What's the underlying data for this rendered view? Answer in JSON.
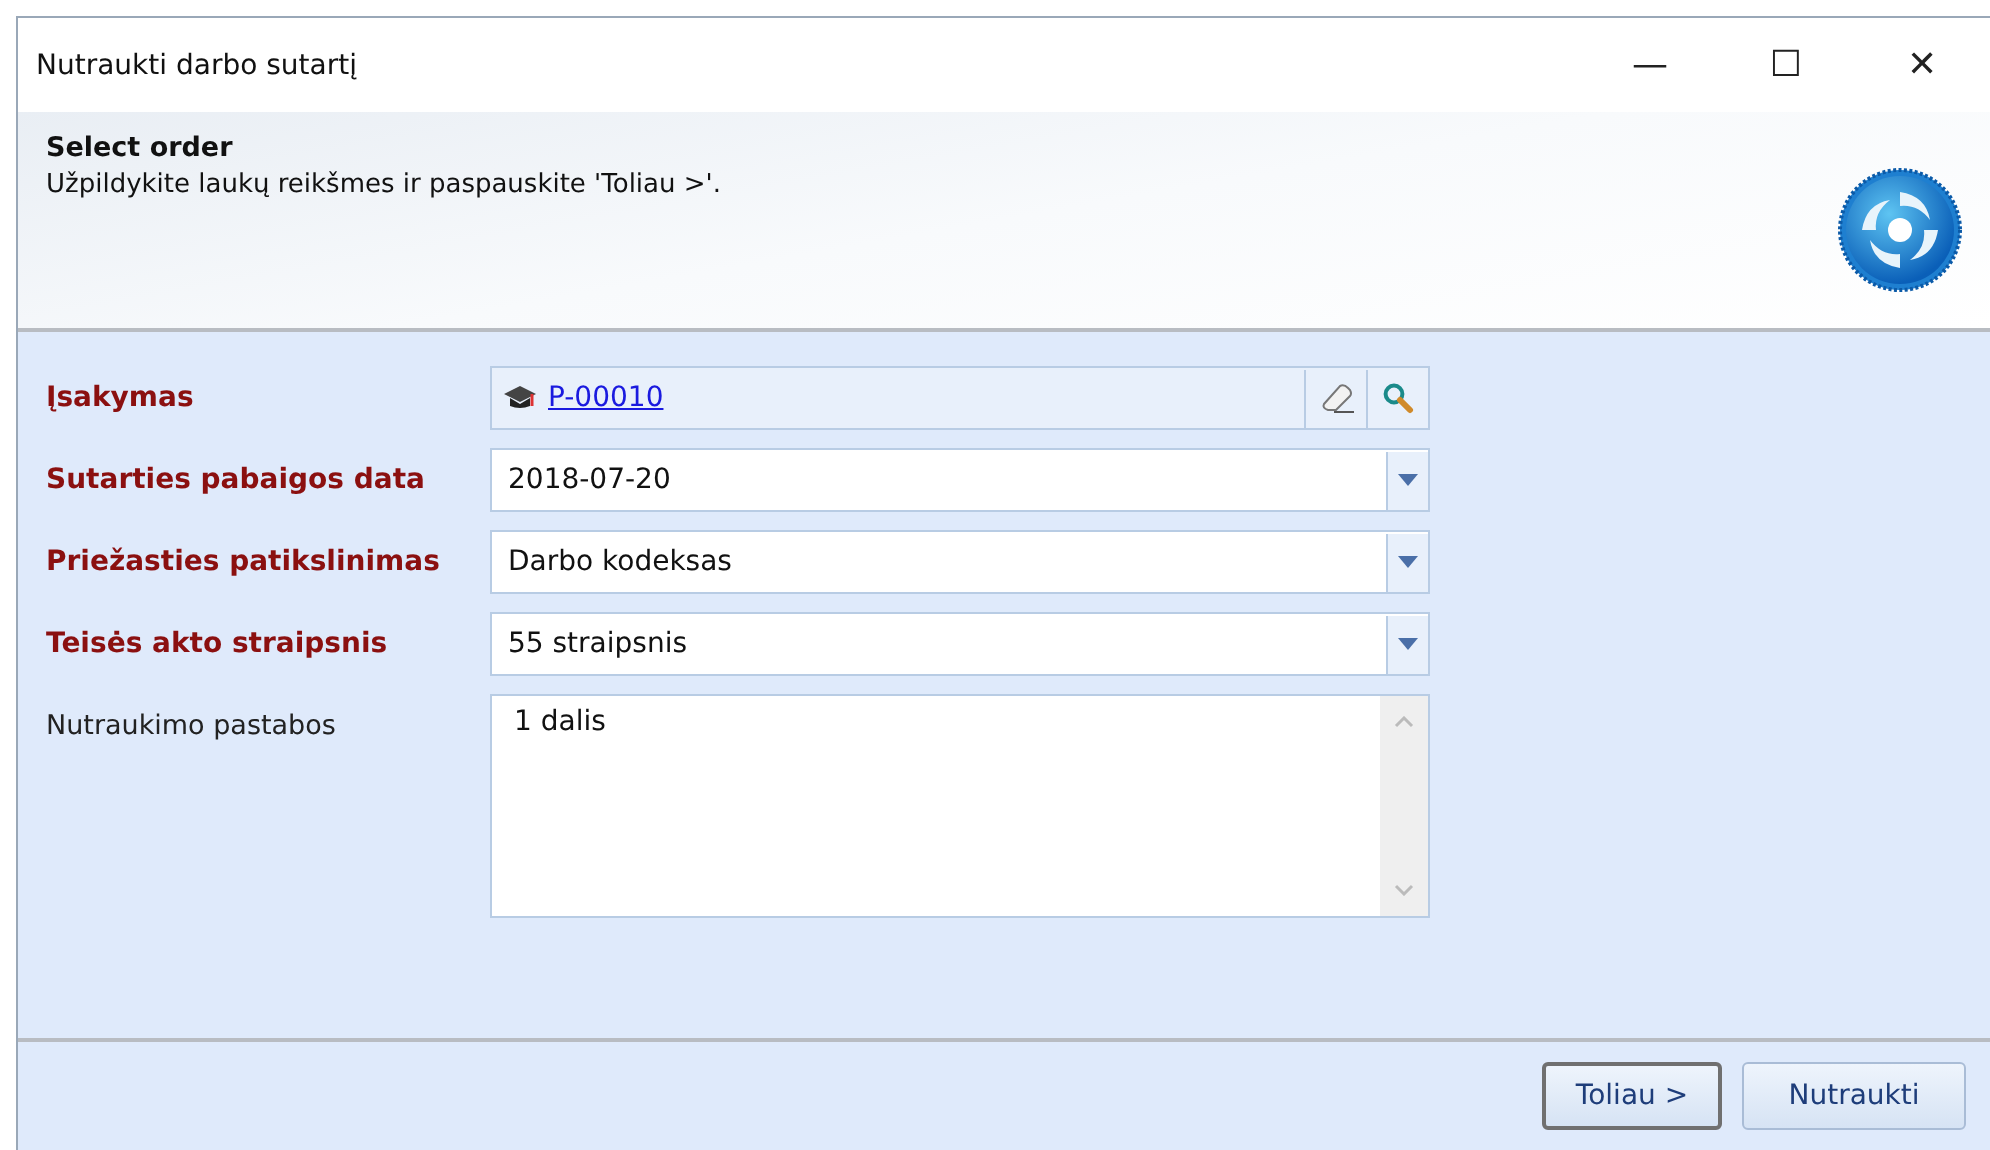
{
  "window": {
    "title": "Nutraukti darbo sutartį",
    "controls": [
      "—",
      "☐",
      "✕"
    ]
  },
  "header": {
    "title": "Select order",
    "subtitle": "Užpildykite laukų reikšmes ir paspauskite 'Toliau >'."
  },
  "fields": [
    {
      "kind": "lookup",
      "label": "Įsakymas",
      "required": true,
      "value": "P-00010"
    },
    {
      "kind": "dropdown",
      "label": "Sutarties pabaigos data",
      "required": true,
      "value": "2018-07-20"
    },
    {
      "kind": "dropdown",
      "label": "Priežasties patikslinimas",
      "required": true,
      "value": "Darbo kodeksas"
    },
    {
      "kind": "dropdown",
      "label": "Teisės akto straipsnis",
      "required": true,
      "value": "55 straipsnis"
    },
    {
      "kind": "memo",
      "label": "Nutraukimo pastabos",
      "required": false,
      "value": "1 dalis"
    }
  ],
  "buttons": [
    {
      "label": "Toliau >",
      "default": true
    },
    {
      "label": "Nutraukti",
      "default": false
    }
  ]
}
